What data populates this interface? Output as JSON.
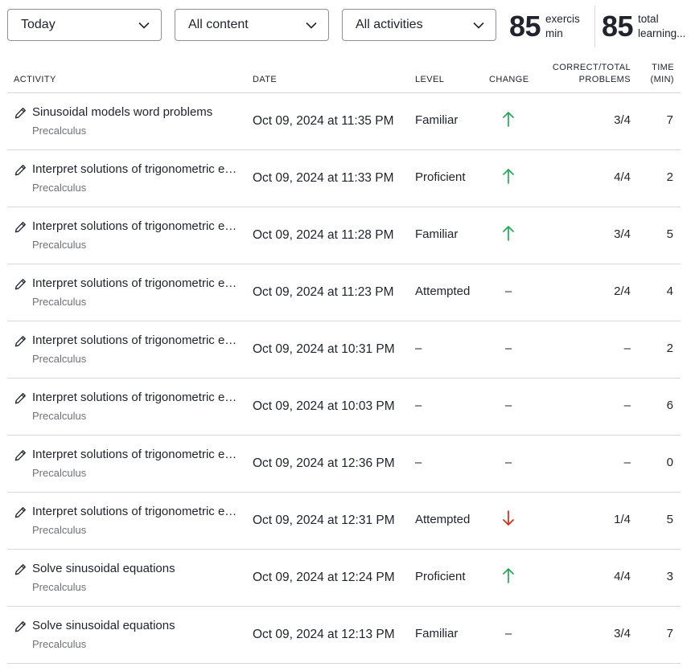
{
  "filters": {
    "time_range": "Today",
    "content": "All content",
    "activities": "All activities"
  },
  "stats": {
    "exercise": {
      "value": "85",
      "label_line1": "exercis",
      "label_line2": "min"
    },
    "learning": {
      "value": "85",
      "label_line1": "total",
      "label_line2": "learning..."
    }
  },
  "colors": {
    "up_arrow": "#1fab54",
    "down_arrow": "#d92916",
    "border": "#d6d8da"
  },
  "table": {
    "headers": {
      "activity": "ACTIVITY",
      "date": "DATE",
      "level": "LEVEL",
      "change": "CHANGE",
      "problems_line1": "CORRECT/TOTAL",
      "problems_line2": "PROBLEMS",
      "time_line1": "TIME",
      "time_line2": "(MIN)"
    },
    "rows": [
      {
        "title": "Sinusoidal models word problems",
        "course": "Precalculus",
        "date": "Oct 09, 2024 at 11:35 PM",
        "level": "Familiar",
        "change": "up",
        "problems": "3/4",
        "time": "7"
      },
      {
        "title": "Interpret solutions of trigonometric equations",
        "course": "Precalculus",
        "date": "Oct 09, 2024 at 11:33 PM",
        "level": "Proficient",
        "change": "up",
        "problems": "4/4",
        "time": "2"
      },
      {
        "title": "Interpret solutions of trigonometric equations",
        "course": "Precalculus",
        "date": "Oct 09, 2024 at 11:28 PM",
        "level": "Familiar",
        "change": "up",
        "problems": "3/4",
        "time": "5"
      },
      {
        "title": "Interpret solutions of trigonometric equations",
        "course": "Precalculus",
        "date": "Oct 09, 2024 at 11:23 PM",
        "level": "Attempted",
        "change": "–",
        "problems": "2/4",
        "time": "4"
      },
      {
        "title": "Interpret solutions of trigonometric equations",
        "course": "Precalculus",
        "date": "Oct 09, 2024 at 10:31 PM",
        "level": "–",
        "change": "–",
        "problems": "–",
        "time": "2"
      },
      {
        "title": "Interpret solutions of trigonometric equations",
        "course": "Precalculus",
        "date": "Oct 09, 2024 at 10:03 PM",
        "level": "–",
        "change": "–",
        "problems": "–",
        "time": "6"
      },
      {
        "title": "Interpret solutions of trigonometric equations",
        "course": "Precalculus",
        "date": "Oct 09, 2024 at 12:36 PM",
        "level": "–",
        "change": "–",
        "problems": "–",
        "time": "0"
      },
      {
        "title": "Interpret solutions of trigonometric equations",
        "course": "Precalculus",
        "date": "Oct 09, 2024 at 12:31 PM",
        "level": "Attempted",
        "change": "down",
        "problems": "1/4",
        "time": "5"
      },
      {
        "title": "Solve sinusoidal equations",
        "course": "Precalculus",
        "date": "Oct 09, 2024 at 12:24 PM",
        "level": "Proficient",
        "change": "up",
        "problems": "4/4",
        "time": "3"
      },
      {
        "title": "Solve sinusoidal equations",
        "course": "Precalculus",
        "date": "Oct 09, 2024 at 12:13 PM",
        "level": "Familiar",
        "change": "–",
        "problems": "3/4",
        "time": "7"
      }
    ]
  }
}
